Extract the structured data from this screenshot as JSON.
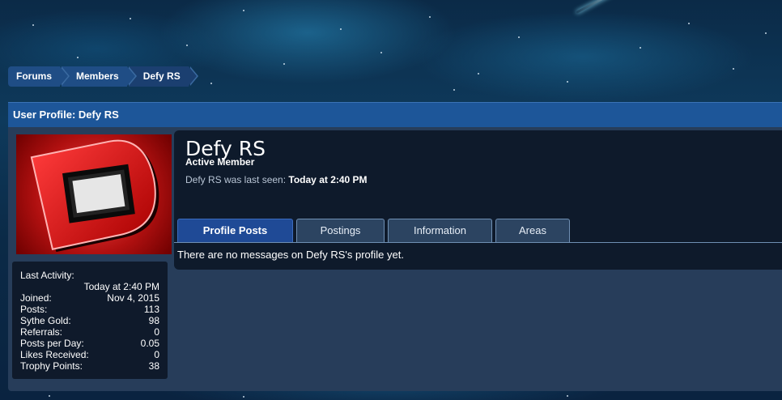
{
  "breadcrumb": [
    "Forums",
    "Members",
    "Defy RS"
  ],
  "panel": {
    "title": "User Profile: Defy RS"
  },
  "profile": {
    "name": "Defy RS",
    "title": "Active Member",
    "last_seen_label": "Defy RS was last seen:",
    "last_seen_value": "Today at 2:40 PM"
  },
  "stats": {
    "last_activity_label": "Last Activity:",
    "last_activity_value": "Today at 2:40 PM",
    "rows": [
      {
        "label": "Joined:",
        "value": "Nov 4, 2015"
      },
      {
        "label": "Posts:",
        "value": "113"
      },
      {
        "label": "Sythe Gold:",
        "value": "98"
      },
      {
        "label": "Referrals:",
        "value": "0"
      },
      {
        "label": "Posts per Day:",
        "value": "0.05"
      },
      {
        "label": "Likes Received:",
        "value": "0"
      },
      {
        "label": "Trophy Points:",
        "value": "38"
      }
    ]
  },
  "tabs": [
    "Profile Posts",
    "Postings",
    "Information",
    "Areas"
  ],
  "active_tab": "Profile Posts",
  "messages": {
    "empty_text": "There are no messages on Defy RS's profile yet."
  },
  "colors": {
    "header_blue": "#1d5699",
    "active_tab": "#1f4a96",
    "panel_bg": "#273d5a",
    "content_bg": "#0e1a2b",
    "avatar_red": "#d81c1c"
  },
  "avatar": {
    "icon": "letter-d-logo"
  }
}
